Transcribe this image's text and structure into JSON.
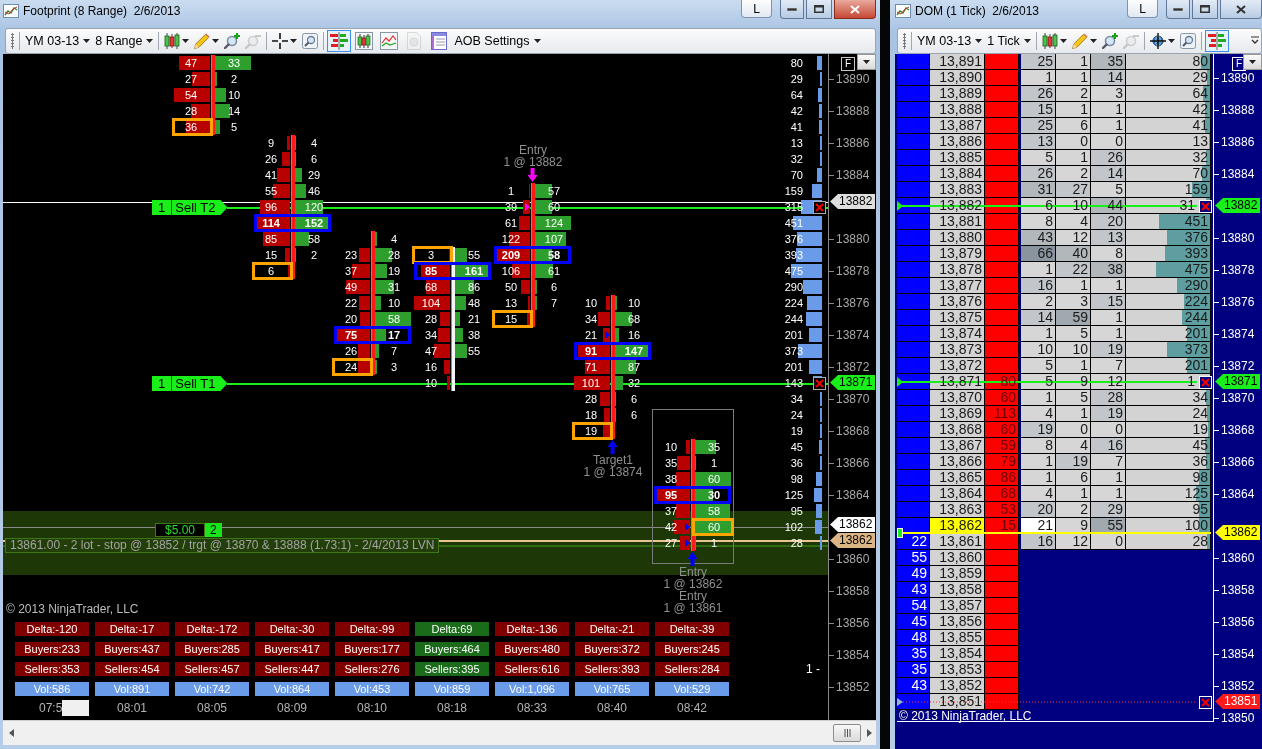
{
  "footprint_window": {
    "title": "Footprint (8 Range)  2/6/2013",
    "title_button": "L",
    "active": true,
    "toolbar": {
      "instrument": "YM 03-13",
      "interval": "8 Range",
      "tools": [
        {
          "kind": "candles",
          "menu": true,
          "disabled": false
        },
        {
          "kind": "pencil",
          "menu": true,
          "disabled": false
        },
        {
          "kind": "zoom-in",
          "menu": false,
          "disabled": false
        },
        {
          "kind": "zoom-out",
          "menu": false,
          "disabled": true
        },
        {
          "kind": "crosshair",
          "menu": true,
          "disabled": false
        },
        {
          "kind": "magnifier",
          "menu": false,
          "disabled": false
        }
      ],
      "chart_styles": [
        {
          "kind": "footprint",
          "selected": true,
          "disabled": false
        },
        {
          "kind": "candlestick",
          "selected": false,
          "disabled": false
        },
        {
          "kind": "line",
          "selected": false,
          "disabled": false
        },
        {
          "kind": "dollar",
          "selected": false,
          "disabled": true
        },
        {
          "kind": "properties",
          "selected": false,
          "disabled": false
        }
      ],
      "settings": "AOB Settings"
    },
    "f_button": "F",
    "zone": {
      "note": "13861.00 - 2 lot - stop @ 13852 / trgt @ 13870 & 13888 (1.73:1) - 2/4/2013 LVN",
      "pnl": "$5.00",
      "quantity": "2"
    },
    "orders": [
      {
        "quantity": "1",
        "label": "Sell T2"
      },
      {
        "quantity": "1",
        "label": "Sell T1"
      }
    ],
    "bars": [
      {
        "kind": "falling",
        "current": false,
        "cells": [
          {
            "kind": "plain",
            "bid": "47",
            "ask": "33"
          },
          {
            "kind": "plain",
            "bid": "27",
            "ask": "2"
          },
          {
            "kind": "plain",
            "bid": "54",
            "ask": "10"
          },
          {
            "kind": "plain",
            "bid": "28",
            "ask": "14"
          },
          {
            "kind": "bid-marked",
            "bid": "36",
            "ask": "5"
          }
        ]
      },
      {
        "kind": "falling",
        "current": false,
        "cells": [
          {
            "kind": "plain",
            "bid": "9",
            "ask": "4"
          },
          {
            "kind": "plain",
            "bid": "26",
            "ask": "6"
          },
          {
            "kind": "plain",
            "bid": "41",
            "ask": "29"
          },
          {
            "kind": "plain",
            "bid": "55",
            "ask": "46"
          },
          {
            "kind": "plain",
            "bid": "96",
            "ask": "120"
          },
          {
            "kind": "pair-marked",
            "bid": "114",
            "ask": "152"
          },
          {
            "kind": "plain",
            "bid": "85",
            "ask": "58"
          },
          {
            "kind": "plain",
            "bid": "15",
            "ask": "2"
          },
          {
            "kind": "bid-marked",
            "bid": "6"
          }
        ]
      },
      {
        "kind": "falling",
        "current": false,
        "cells": [
          {
            "kind": "plain",
            "ask": "4"
          },
          {
            "kind": "plain",
            "bid": "23",
            "ask": "28"
          },
          {
            "kind": "plain",
            "bid": "37",
            "ask": "19"
          },
          {
            "kind": "plain",
            "bid": "49",
            "ask": "31"
          },
          {
            "kind": "plain",
            "bid": "22",
            "ask": "10"
          },
          {
            "kind": "plain",
            "bid": "20",
            "ask": "58"
          },
          {
            "kind": "pair-marked",
            "bid": "75",
            "ask": "17"
          },
          {
            "kind": "plain",
            "bid": "26",
            "ask": "7"
          },
          {
            "kind": "bid-marked",
            "bid": "24",
            "ask": "3"
          }
        ]
      },
      {
        "kind": "rising",
        "current": false,
        "cells": [
          {
            "kind": "bid-marked",
            "bid": "3",
            "ask": "55"
          },
          {
            "kind": "pair-marked",
            "bid": "85",
            "ask": "161"
          },
          {
            "kind": "plain",
            "bid": "68",
            "ask": "86"
          },
          {
            "kind": "plain",
            "bid": "104",
            "ask": "48"
          },
          {
            "kind": "plain",
            "bid": "28",
            "ask": "21"
          },
          {
            "kind": "plain",
            "bid": "34",
            "ask": "38"
          },
          {
            "kind": "plain",
            "bid": "47",
            "ask": "55"
          },
          {
            "kind": "plain",
            "bid": "16"
          },
          {
            "kind": "plain",
            "bid": "10"
          }
        ]
      },
      {
        "kind": "falling",
        "current": false,
        "cells": [
          {
            "kind": "plain",
            "bid": "1",
            "ask": "57"
          },
          {
            "kind": "plain",
            "bid": "39",
            "ask": "60"
          },
          {
            "kind": "plain",
            "bid": "61",
            "ask": "124"
          },
          {
            "kind": "plain",
            "bid": "122",
            "ask": "107"
          },
          {
            "kind": "pair-marked",
            "bid": "209",
            "ask": "58"
          },
          {
            "kind": "plain",
            "bid": "106",
            "ask": "61"
          },
          {
            "kind": "plain",
            "bid": "50",
            "ask": "6"
          },
          {
            "kind": "plain",
            "bid": "13",
            "ask": "7"
          },
          {
            "kind": "bid-marked",
            "bid": "15"
          }
        ],
        "executions": [
          {
            "kind": "sell",
            "label": "Entry",
            "detail": "1 @ 13882"
          }
        ]
      },
      {
        "kind": "falling",
        "current": false,
        "cells": [
          {
            "kind": "plain",
            "bid": "10",
            "ask": "10"
          },
          {
            "kind": "plain",
            "bid": "34",
            "ask": "68"
          },
          {
            "kind": "plain",
            "bid": "21",
            "ask": "16"
          },
          {
            "kind": "pair-marked",
            "bid": "91",
            "ask": "147"
          },
          {
            "kind": "plain",
            "bid": "71",
            "ask": "87"
          },
          {
            "kind": "plain",
            "bid": "101",
            "ask": "32"
          },
          {
            "kind": "plain",
            "bid": "28",
            "ask": "6"
          },
          {
            "kind": "plain",
            "bid": "18",
            "ask": "6"
          },
          {
            "kind": "bid-marked",
            "bid": "19"
          }
        ],
        "executions": [
          {
            "kind": "buy",
            "label": "Target1",
            "detail": "1 @ 13874"
          }
        ]
      },
      {
        "kind": "falling",
        "current": true,
        "cells": [
          {
            "kind": "plain",
            "bid": "10",
            "ask": "35"
          },
          {
            "kind": "plain",
            "bid": "35",
            "ask": "1"
          },
          {
            "kind": "plain",
            "bid": "38",
            "ask": "60"
          },
          {
            "kind": "pair-marked",
            "bid": "95",
            "ask": "30"
          },
          {
            "kind": "plain",
            "bid": "37",
            "ask": "58"
          },
          {
            "kind": "ask-marked",
            "bid": "42",
            "ask": "60"
          },
          {
            "kind": "plain",
            "bid": "27",
            "ask": "1"
          }
        ],
        "executions": [
          {
            "kind": "buy",
            "label": "Entry",
            "detail": "1 @ 13862"
          },
          {
            "kind": "buy",
            "label": "Entry",
            "detail": "1 @ 13861"
          }
        ]
      }
    ],
    "profile": [
      "80",
      "29",
      "64",
      "42",
      "41",
      "13",
      "32",
      "70",
      "159",
      "315",
      "451",
      "376",
      "393",
      "475",
      "290",
      "224",
      "244",
      "201",
      "373",
      "201",
      "143",
      "34",
      "24",
      "19",
      "45",
      "36",
      "98",
      "125",
      "95",
      "102",
      "28"
    ],
    "axis_labels": [
      "13890",
      "13888",
      "13886",
      "13884",
      "13880",
      "13878",
      "13876",
      "13874",
      "13872",
      "13870",
      "13868",
      "13866",
      "13864",
      "13860",
      "13858",
      "13856",
      "13854",
      "13852"
    ],
    "flags": [
      {
        "text": "13882",
        "kind": "line"
      },
      {
        "text": "13871",
        "kind": "order"
      },
      {
        "text": "13862",
        "kind": "last"
      },
      {
        "text": "13862",
        "kind": "position"
      }
    ],
    "columns": [
      {
        "time": "07:5",
        "covered": true,
        "color": "#800000",
        "delta": "Delta:-120",
        "buyers": "Buyers:233",
        "sellers": "Sellers:353",
        "volume": "Vol:586"
      },
      {
        "time": "08:01",
        "covered": false,
        "color": "#800000",
        "delta": "Delta:-17",
        "buyers": "Buyers:437",
        "sellers": "Sellers:454",
        "volume": "Vol:891"
      },
      {
        "time": "08:05",
        "covered": false,
        "color": "#800000",
        "delta": "Delta:-172",
        "buyers": "Buyers:285",
        "sellers": "Sellers:457",
        "volume": "Vol:742"
      },
      {
        "time": "08:09",
        "covered": false,
        "color": "#800000",
        "delta": "Delta:-30",
        "buyers": "Buyers:417",
        "sellers": "Sellers:447",
        "volume": "Vol:864"
      },
      {
        "time": "08:10",
        "covered": false,
        "color": "#800000",
        "delta": "Delta:-99",
        "buyers": "Buyers:177",
        "sellers": "Sellers:276",
        "volume": "Vol:453"
      },
      {
        "time": "08:18",
        "covered": false,
        "color": "#1a6b1a",
        "delta": "Delta:69",
        "buyers": "Buyers:464",
        "sellers": "Sellers:395",
        "volume": "Vol:859"
      },
      {
        "time": "08:33",
        "covered": false,
        "color": "#800000",
        "delta": "Delta:-136",
        "buyers": "Buyers:480",
        "sellers": "Sellers:616",
        "volume": "Vol:1,096"
      },
      {
        "time": "08:40",
        "covered": false,
        "color": "#800000",
        "delta": "Delta:-21",
        "buyers": "Buyers:372",
        "sellers": "Sellers:393",
        "volume": "Vol:765"
      },
      {
        "time": "08:42",
        "covered": false,
        "color": "#800000",
        "delta": "Delta:-39",
        "buyers": "Buyers:245",
        "sellers": "Sellers:284",
        "volume": "Vol:529"
      }
    ],
    "side_label": "1 -",
    "copyright": "© 2013 NinjaTrader, LLC"
  },
  "dom_window": {
    "title": "DOM (1 Tick)  2/6/2013",
    "title_button": "L",
    "active": false,
    "toolbar": {
      "instrument": "YM 03-13",
      "interval": "1 Tick",
      "tools": [
        {
          "kind": "candles",
          "menu": true,
          "disabled": false
        },
        {
          "kind": "pencil",
          "menu": true,
          "disabled": false
        },
        {
          "kind": "zoom-in",
          "menu": false,
          "disabled": false
        },
        {
          "kind": "zoom-out",
          "menu": false,
          "disabled": true
        },
        {
          "kind": "globe",
          "menu": true,
          "disabled": false
        },
        {
          "kind": "magnifier",
          "menu": false,
          "disabled": false
        }
      ],
      "chart_styles": [
        {
          "kind": "footprint",
          "selected": true,
          "disabled": false
        }
      ]
    },
    "f_button": "F",
    "rows": [
      {
        "column_2": "13,891",
        "column_4": "25",
        "column_5": "1",
        "column_6": "35",
        "column_7": "80",
        "last": false
      },
      {
        "column_2": "13,890",
        "column_4": "1",
        "column_5": "1",
        "column_6": "14",
        "column_7": "29",
        "last": false
      },
      {
        "column_2": "13,889",
        "column_4": "26",
        "column_5": "2",
        "column_6": "3",
        "column_7": "64",
        "last": false
      },
      {
        "column_2": "13,888",
        "column_4": "15",
        "column_5": "1",
        "column_6": "1",
        "column_7": "42",
        "last": false
      },
      {
        "column_2": "13,887",
        "column_4": "25",
        "column_5": "6",
        "column_6": "1",
        "column_7": "41",
        "last": false
      },
      {
        "column_2": "13,886",
        "column_4": "13",
        "column_5": "0",
        "column_6": "0",
        "column_7": "13",
        "last": false
      },
      {
        "column_2": "13,885",
        "column_4": "5",
        "column_5": "1",
        "column_6": "26",
        "column_7": "32",
        "last": false
      },
      {
        "column_2": "13,884",
        "column_4": "26",
        "column_5": "2",
        "column_6": "14",
        "column_7": "70",
        "last": false
      },
      {
        "column_2": "13,883",
        "column_4": "31",
        "column_5": "27",
        "column_6": "5",
        "column_7": "159",
        "last": false
      },
      {
        "column_2": "13,882",
        "column_4": "6",
        "column_5": "10",
        "column_6": "44",
        "column_7": "31",
        "last": false
      },
      {
        "column_2": "13,881",
        "column_4": "8",
        "column_5": "4",
        "column_6": "20",
        "column_7": "451",
        "last": false
      },
      {
        "column_2": "13,880",
        "column_4": "43",
        "column_5": "12",
        "column_6": "13",
        "column_7": "376",
        "last": false
      },
      {
        "column_2": "13,879",
        "column_4": "66",
        "column_5": "40",
        "column_6": "8",
        "column_7": "393",
        "last": false
      },
      {
        "column_2": "13,878",
        "column_4": "1",
        "column_5": "22",
        "column_6": "38",
        "column_7": "475",
        "last": false
      },
      {
        "column_2": "13,877",
        "column_4": "16",
        "column_5": "1",
        "column_6": "1",
        "column_7": "290",
        "last": false
      },
      {
        "column_2": "13,876",
        "column_4": "2",
        "column_5": "3",
        "column_6": "15",
        "column_7": "224",
        "last": false
      },
      {
        "column_2": "13,875",
        "column_4": "14",
        "column_5": "59",
        "column_6": "1",
        "column_7": "244",
        "last": false
      },
      {
        "column_2": "13,874",
        "column_4": "1",
        "column_5": "5",
        "column_6": "1",
        "column_7": "201",
        "last": false
      },
      {
        "column_2": "13,873",
        "column_4": "10",
        "column_5": "10",
        "column_6": "19",
        "column_7": "373",
        "last": false
      },
      {
        "column_2": "13,872",
        "column_4": "5",
        "column_5": "1",
        "column_6": "7",
        "column_7": "201",
        "last": false
      },
      {
        "column_2": "13,871",
        "column_3": "80",
        "column_4": "5",
        "column_5": "9",
        "column_6": "12",
        "column_7": "1",
        "last": false
      },
      {
        "column_2": "13,870",
        "column_3": "60",
        "column_4": "1",
        "column_5": "5",
        "column_6": "28",
        "column_7": "34",
        "last": false
      },
      {
        "column_2": "13,869",
        "column_3": "113",
        "column_4": "4",
        "column_5": "1",
        "column_6": "19",
        "column_7": "24",
        "last": false
      },
      {
        "column_2": "13,868",
        "column_3": "60",
        "column_4": "19",
        "column_5": "0",
        "column_6": "0",
        "column_7": "19",
        "last": false
      },
      {
        "column_2": "13,867",
        "column_3": "59",
        "column_4": "8",
        "column_5": "4",
        "column_6": "16",
        "column_7": "45",
        "last": false
      },
      {
        "column_2": "13,866",
        "column_3": "79",
        "column_4": "1",
        "column_5": "19",
        "column_6": "7",
        "column_7": "36",
        "last": false
      },
      {
        "column_2": "13,865",
        "column_3": "86",
        "column_4": "1",
        "column_5": "6",
        "column_6": "1",
        "column_7": "98",
        "last": false
      },
      {
        "column_2": "13,864",
        "column_3": "68",
        "column_4": "4",
        "column_5": "1",
        "column_6": "1",
        "column_7": "125",
        "last": false
      },
      {
        "column_2": "13,863",
        "column_3": "53",
        "column_4": "20",
        "column_5": "2",
        "column_6": "29",
        "column_7": "95",
        "last": false
      },
      {
        "column_2": "13,862",
        "column_3": "15",
        "column_4": "21",
        "column_5": "9",
        "column_6": "55",
        "column_7": "100",
        "last": true
      },
      {
        "column_1": "22",
        "column_2": "13,861",
        "column_4": "16",
        "column_5": "12",
        "column_6": "0",
        "column_7": "28",
        "last": false
      },
      {
        "column_1": "55",
        "column_2": "13,860",
        "last": false
      },
      {
        "column_1": "49",
        "column_2": "13,859",
        "last": false
      },
      {
        "column_1": "43",
        "column_2": "13,858",
        "last": false
      },
      {
        "column_1": "54",
        "column_2": "13,857",
        "last": false
      },
      {
        "column_1": "45",
        "column_2": "13,856",
        "last": false
      },
      {
        "column_1": "48",
        "column_2": "13,855",
        "last": false
      },
      {
        "column_1": "35",
        "column_2": "13,854",
        "last": false
      },
      {
        "column_1": "35",
        "column_2": "13,853",
        "last": false
      },
      {
        "column_1": "43",
        "column_2": "13,852",
        "last": false
      },
      {
        "column_2": "13,851",
        "last": false
      }
    ],
    "axis_labels": [
      "13890",
      "13888",
      "13886",
      "13884",
      "13880",
      "13878",
      "13876",
      "13874",
      "13872",
      "13870",
      "13868",
      "13866",
      "13864",
      "13860",
      "13858",
      "13856",
      "13854",
      "13852",
      "13850"
    ],
    "flags": [
      {
        "text": "13882",
        "kind": "order"
      },
      {
        "text": "13871",
        "kind": "order"
      },
      {
        "text": "13862",
        "kind": "position"
      },
      {
        "text": "13851",
        "kind": "stop"
      }
    ],
    "copyright": "© 2013 NinjaTrader, LLC"
  }
}
